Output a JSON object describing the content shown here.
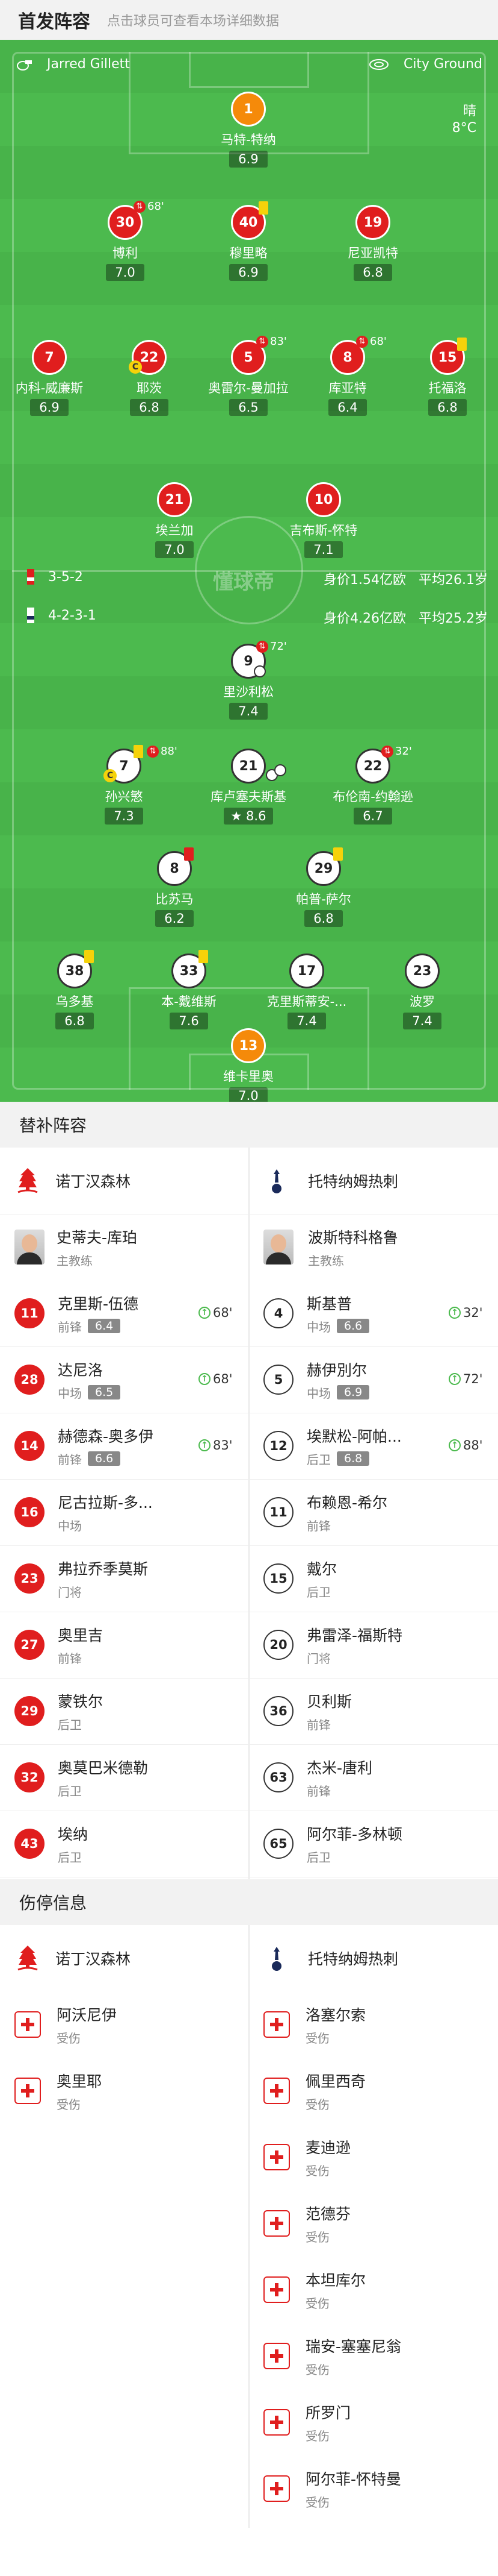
{
  "header": {
    "title": "首发阵容",
    "subtitle": "点击球员可查看本场详细数据"
  },
  "pitch": {
    "referee": "Jarred Gillett",
    "stadium": "City Ground",
    "weather": "晴",
    "temp": "8°C",
    "home_formation": "3-5-2",
    "home_value": "身价1.54亿欧",
    "home_age": "平均26.1岁",
    "away_formation": "4-2-3-1",
    "away_value": "身价4.26亿欧",
    "away_age": "平均25.2岁",
    "watermark": "懂球帝"
  },
  "home_players": [
    {
      "num": "1",
      "name": "马特-特纳",
      "rating": "6.9",
      "kit": "orange"
    },
    {
      "num": "30",
      "name": "博利",
      "rating": "7.0",
      "sub": "68'"
    },
    {
      "num": "40",
      "name": "穆里略",
      "rating": "6.9"
    },
    {
      "num": "19",
      "name": "尼亚凯特",
      "rating": "6.8"
    },
    {
      "num": "7",
      "name": "内科-威廉斯",
      "rating": "6.9"
    },
    {
      "num": "22",
      "name": "耶茨",
      "rating": "6.8"
    },
    {
      "num": "5",
      "name": "奥雷尔-曼加拉",
      "rating": "6.5",
      "sub": "83'"
    },
    {
      "num": "8",
      "name": "库亚特",
      "rating": "6.4",
      "sub": "68'"
    },
    {
      "num": "15",
      "name": "托福洛",
      "rating": "6.8"
    },
    {
      "num": "21",
      "name": "埃兰加",
      "rating": "7.0"
    },
    {
      "num": "10",
      "name": "吉布斯-怀特",
      "rating": "7.1"
    }
  ],
  "away_players": [
    {
      "num": "9",
      "name": "里沙利松",
      "rating": "7.4",
      "sub": "72'"
    },
    {
      "num": "7",
      "name": "孙兴慜",
      "rating": "7.3",
      "sub": "88'"
    },
    {
      "num": "21",
      "name": "库卢塞夫斯基",
      "rating": "8.6"
    },
    {
      "num": "22",
      "name": "布伦南-约翰逊",
      "rating": "6.7",
      "sub": "32'"
    },
    {
      "num": "8",
      "name": "比苏马",
      "rating": "6.2"
    },
    {
      "num": "29",
      "name": "帕普-萨尔",
      "rating": "6.8"
    },
    {
      "num": "38",
      "name": "乌多基",
      "rating": "6.8"
    },
    {
      "num": "33",
      "name": "本-戴维斯",
      "rating": "7.6"
    },
    {
      "num": "17",
      "name": "克里斯蒂安-...",
      "rating": "7.4"
    },
    {
      "num": "23",
      "name": "波罗",
      "rating": "7.4"
    },
    {
      "num": "13",
      "name": "维卡里奥",
      "rating": "7.0",
      "kit": "orange"
    }
  ],
  "subs_section": "替补阵容",
  "teams": {
    "home": "诺丁汉森林",
    "away": "托特纳姆热刺"
  },
  "coaches": {
    "home": "史蒂夫-库珀",
    "away": "波斯特科格鲁",
    "role": "主教练"
  },
  "home_subs": [
    {
      "num": "11",
      "name": "克里斯-伍德",
      "pos": "前锋",
      "rating": "6.4",
      "in": "68'"
    },
    {
      "num": "28",
      "name": "达尼洛",
      "pos": "中场",
      "rating": "6.5",
      "in": "68'"
    },
    {
      "num": "14",
      "name": "赫德森-奥多伊",
      "pos": "前锋",
      "rating": "6.6",
      "in": "83'"
    },
    {
      "num": "16",
      "name": "尼古拉斯-多...",
      "pos": "中场"
    },
    {
      "num": "23",
      "name": "弗拉乔季莫斯",
      "pos": "门将"
    },
    {
      "num": "27",
      "name": "奥里吉",
      "pos": "前锋"
    },
    {
      "num": "29",
      "name": "蒙铁尔",
      "pos": "后卫"
    },
    {
      "num": "32",
      "name": "奥莫巴米德勒",
      "pos": "后卫"
    },
    {
      "num": "43",
      "name": "埃纳",
      "pos": "后卫"
    }
  ],
  "away_subs": [
    {
      "num": "4",
      "name": "斯基普",
      "pos": "中场",
      "rating": "6.6",
      "in": "32'"
    },
    {
      "num": "5",
      "name": "赫伊別尔",
      "pos": "中场",
      "rating": "6.9",
      "in": "72'"
    },
    {
      "num": "12",
      "name": "埃默松-阿帕...",
      "pos": "后卫",
      "rating": "6.8",
      "in": "88'"
    },
    {
      "num": "11",
      "name": "布赖恩-希尔",
      "pos": "前锋"
    },
    {
      "num": "15",
      "name": "戴尔",
      "pos": "后卫"
    },
    {
      "num": "20",
      "name": "弗雷泽-福斯特",
      "pos": "门将"
    },
    {
      "num": "36",
      "name": "贝利斯",
      "pos": "前锋"
    },
    {
      "num": "63",
      "name": "杰米-唐利",
      "pos": "前锋"
    },
    {
      "num": "65",
      "name": "阿尔菲-多林顿",
      "pos": "后卫"
    }
  ],
  "injury_section": "伤停信息",
  "injury_status": "受伤",
  "home_injuries": [
    {
      "name": "阿沃尼伊"
    },
    {
      "name": "奥里耶"
    }
  ],
  "away_injuries": [
    {
      "name": "洛塞尔索"
    },
    {
      "name": "佩里西奇"
    },
    {
      "name": "麦迪逊"
    },
    {
      "name": "范德芬"
    },
    {
      "name": "本坦库尔"
    },
    {
      "name": "瑞安-塞塞尼翁"
    },
    {
      "name": "所罗门"
    },
    {
      "name": "阿尔菲-怀特曼"
    }
  ],
  "colors": {
    "pitch": "#4cba4e",
    "home": "#e01e1e",
    "gk": "#f58a0a",
    "away": "#ffffff",
    "sub_in": "#4cba4e"
  }
}
